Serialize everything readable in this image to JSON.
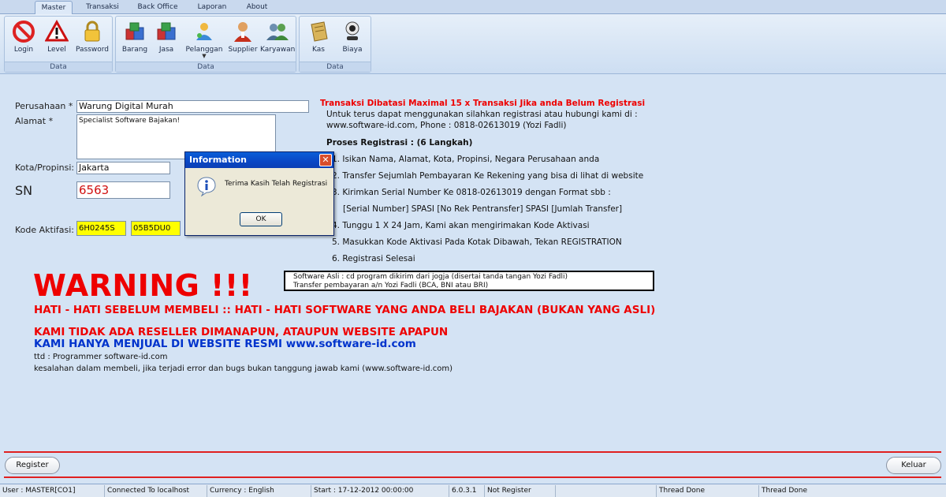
{
  "tabs": [
    "Master",
    "Transaksi",
    "Back Office",
    "Laporan",
    "About"
  ],
  "ribbon": {
    "group_data_1": {
      "label": "Data",
      "buttons": [
        "Login",
        "Level",
        "Password"
      ]
    },
    "group_data_2": {
      "label": "Data",
      "buttons": [
        "Barang",
        "Jasa",
        "Pelanggan",
        "Supplier",
        "Karyawan"
      ]
    },
    "group_data_3": {
      "label": "Data",
      "buttons": [
        "Kas",
        "Biaya"
      ]
    },
    "icons": {
      "login": "no-entry-icon",
      "level": "warning-triangle-icon",
      "password": "padlock-icon",
      "barang": "boxes-icon",
      "jasa": "boxes-icon",
      "pelanggan": "customer-icon",
      "supplier": "supplier-person-icon",
      "karyawan": "people-icon",
      "kas": "cash-book-icon",
      "biaya": "webcam-icon"
    }
  },
  "form": {
    "perusahaan_label": "Perusahaan *",
    "perusahaan_value": "Warung Digital Murah",
    "alamat_label": "Alamat *",
    "alamat_value": "Specialist Software Bajakan!",
    "kota_label": "Kota/Propinsi:",
    "kota_value": "Jakarta",
    "sn_label": "SN",
    "sn_value": "6563",
    "kode_label": "Kode Aktifasi:",
    "kode_1": "6H0245S",
    "kode_2": "05B5DU0"
  },
  "info": {
    "title": "Transaksi Dibatasi Maximal 15 x Transaksi Jika anda Belum Registrasi",
    "line1": "Untuk terus dapat menggunakan silahkan registrasi atau hubungi kami di :",
    "line2": "www.software-id.com, Phone : 0818-02613019 (Yozi Fadli)",
    "steps_title": "Proses Registrasi : (6 Langkah)",
    "step1": "1. Isikan Nama, Alamat, Kota, Propinsi, Negara Perusahaan anda",
    "step2": "2. Transfer Sejumlah Pembayaran Ke Rekening yang bisa di lihat di website",
    "step3": "3. Kirimkan Serial Number Ke 0818-02613019 dengan Format sbb :",
    "step3b": "[Serial Number] SPASI [No Rek Pentransfer] SPASI [Jumlah Transfer]",
    "step4": "4. Tunggu 1 X 24 Jam, Kami akan mengirimakan Kode Aktivasi",
    "step5": "5. Masukkan Kode Aktivasi Pada Kotak Dibawah, Tekan REGISTRATION",
    "step6": "6. Registrasi Selesai"
  },
  "note": {
    "line1": "Software Asli : cd program dikirim dari jogja (disertai tanda tangan Yozi Fadli)",
    "line2": "Transfer pembayaran a/n Yozi Fadli (BCA, BNI atau BRI)"
  },
  "warning": {
    "title": "WARNING !!!",
    "line1": "HATI - HATI SEBELUM MEMBELI :: HATI - HATI SOFTWARE YANG ANDA BELI BAJAKAN (BUKAN YANG ASLI)",
    "line2": "KAMI TIDAK ADA RESELLER DIMANAPUN, ATAUPUN WEBSITE APAPUN",
    "line3": "KAMI HANYA MENJUAL DI WEBSITE RESMI www.software-id.com",
    "ttd": "ttd : Programmer software-id.com",
    "disclaimer": "kesalahan dalam membeli, jika terjadi error dan bugs bukan tanggung jawab kami (www.software-id.com)"
  },
  "dialog": {
    "title": "Information",
    "message": "Terima Kasih Telah Registrasi",
    "ok": "OK",
    "close": "✕"
  },
  "buttons": {
    "register": "Register",
    "keluar": "Keluar"
  },
  "status": [
    "User : MASTER[CO1]",
    "Connected To localhost",
    "Currency : English",
    "Start  : 17-12-2012 00:00:00",
    "6.0.3.1",
    "Not Register",
    "",
    "Thread Done",
    "Thread Done"
  ],
  "colors": {
    "background": "#d4e3f4",
    "warning_red": "#e00000",
    "accent_blue": "#0033cc",
    "activation_yellow": "#ffff00",
    "dialog_title": "#0a46c4"
  }
}
